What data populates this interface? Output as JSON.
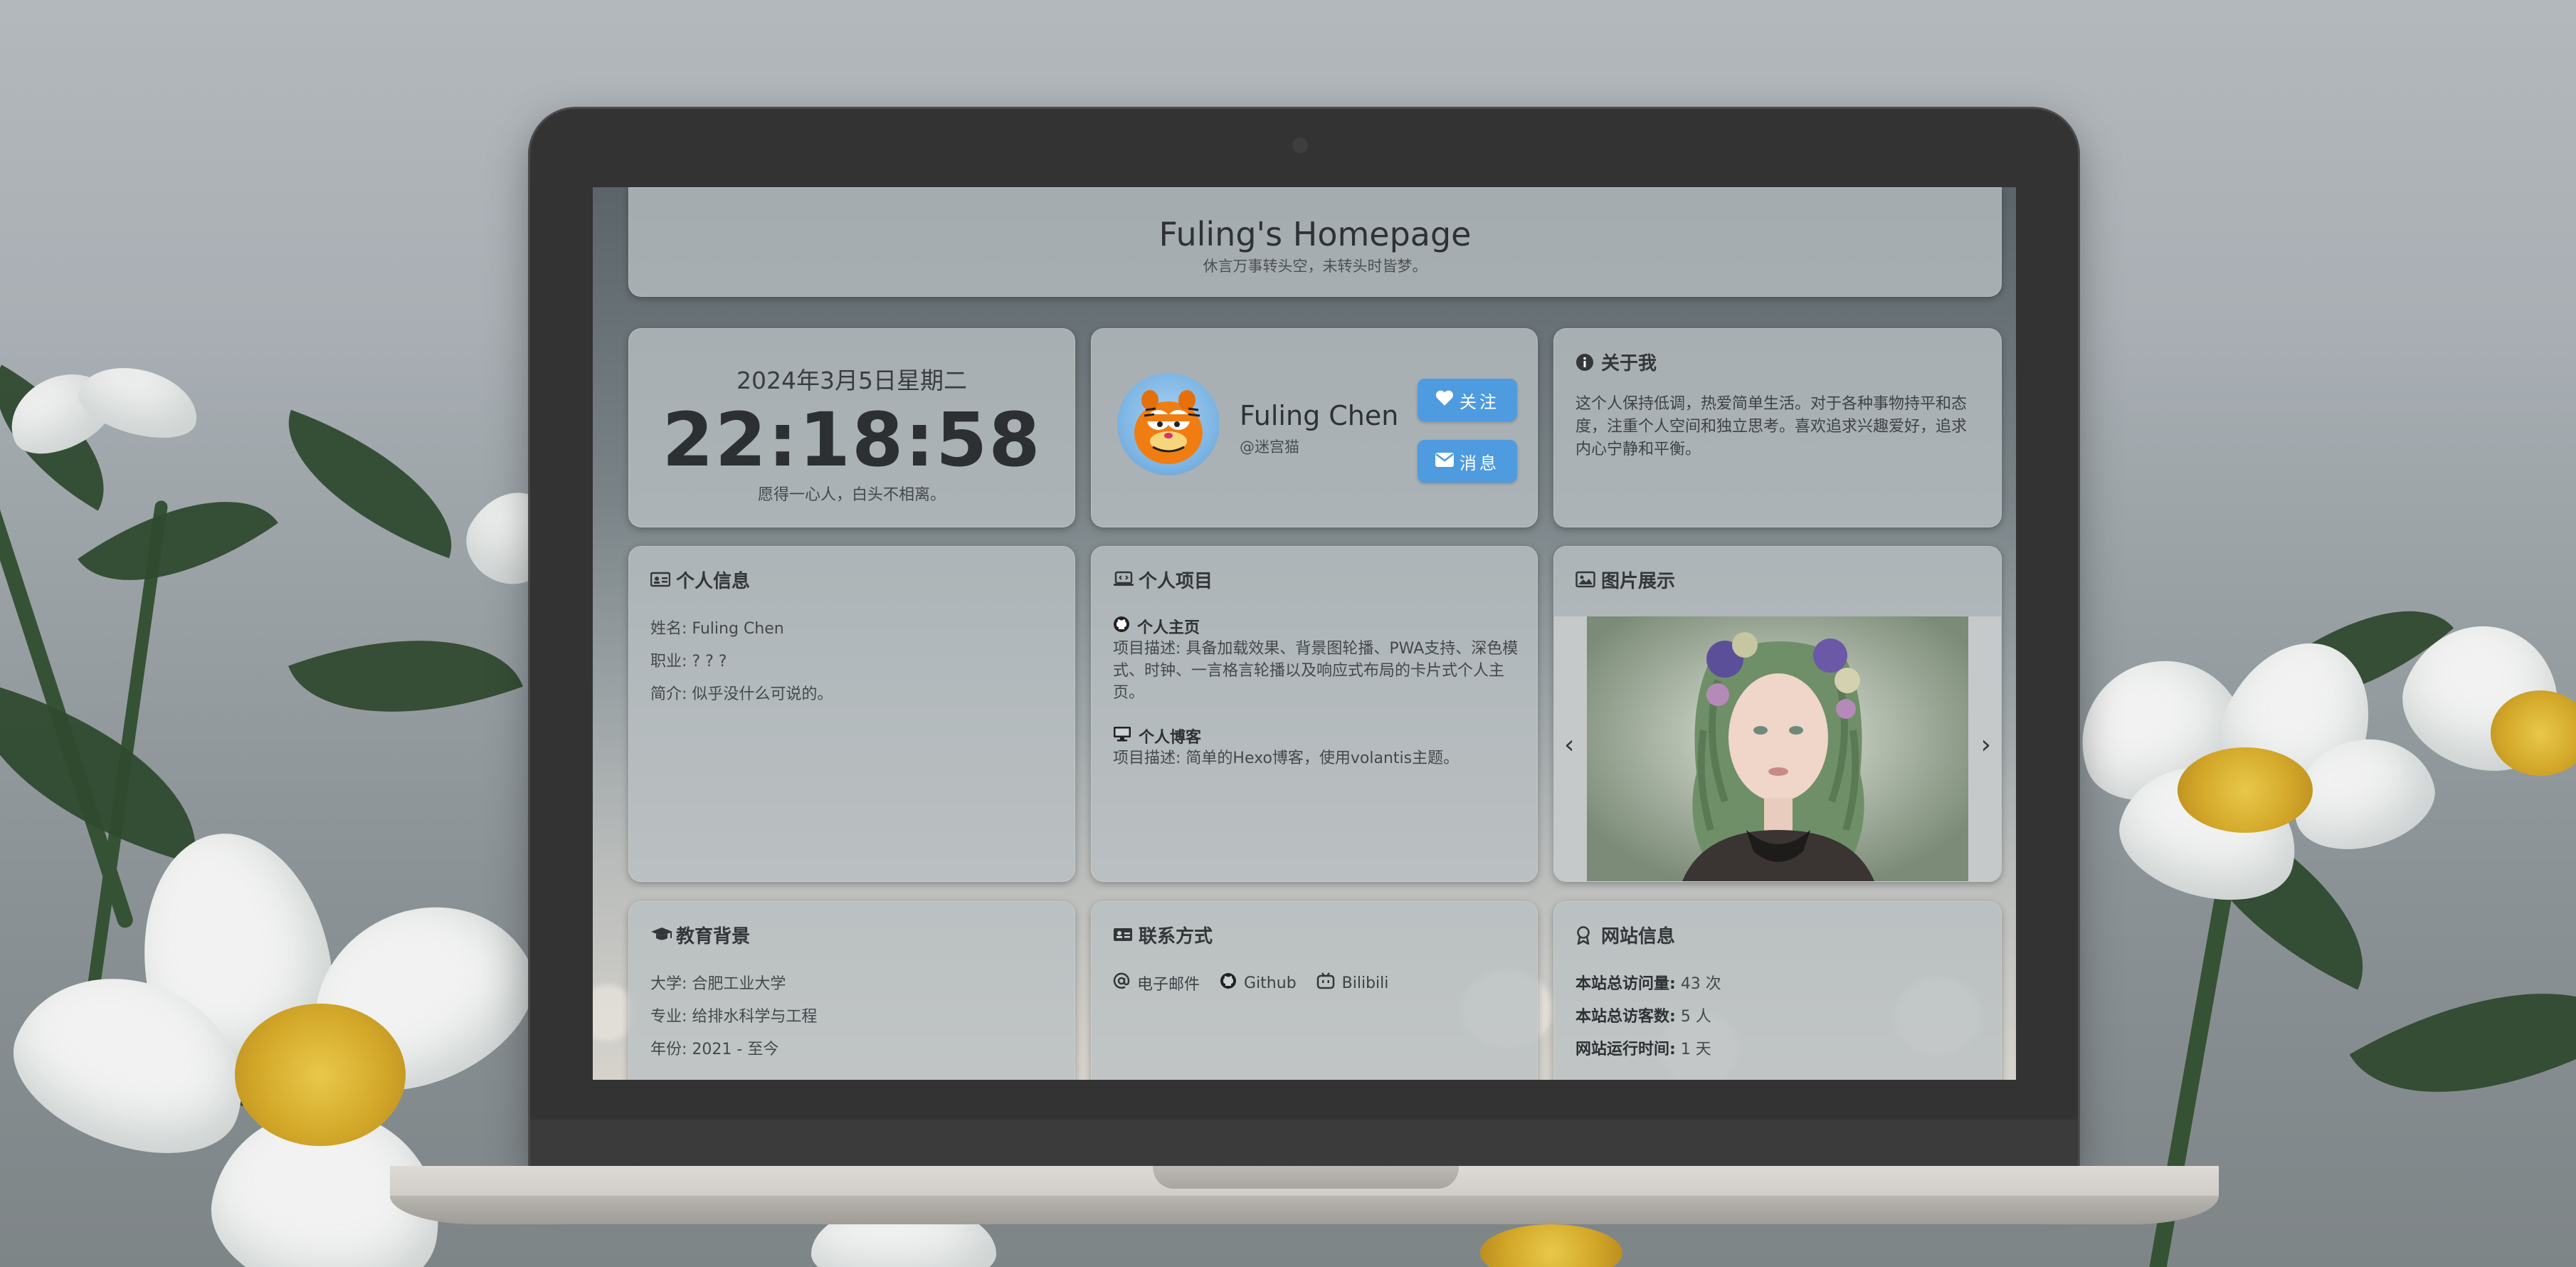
{
  "header": {
    "title": "Fuling's Homepage",
    "subtitle": "休言万事转头空，未转头时皆梦。"
  },
  "clock": {
    "date": "2024年3月5日星期二",
    "time": "22:18:58",
    "motto": "愿得一心人，白头不相离。"
  },
  "profile": {
    "name": "Fuling Chen",
    "handle": "@迷宫猫",
    "follow_label": "关注",
    "message_label": "消息"
  },
  "about": {
    "title": "关于我",
    "text": "这个人保持低调，热爱简单生活。对于各种事物持平和态度，注重个人空间和独立思考。喜欢追求兴趣爱好，追求内心宁静和平衡。"
  },
  "personal_info": {
    "title": "个人信息",
    "name_line": "姓名: Fuling Chen",
    "job_line": "职业: ? ? ?",
    "bio_line": "简介: 似乎没什么可说的。"
  },
  "projects": {
    "title": "个人项目",
    "items": [
      {
        "name": "个人主页",
        "desc": "项目描述: 具备加载效果、背景图轮播、PWA支持、深色模式、时钟、一言格言轮播以及响应式布局的卡片式个人主页。"
      },
      {
        "name": "个人博客",
        "desc": "项目描述: 简单的Hexo博客，使用volantis主题。"
      }
    ]
  },
  "gallery": {
    "title": "图片展示",
    "prev": "‹",
    "next": "›"
  },
  "education": {
    "title": "教育背景",
    "school_line": "大学: 合肥工业大学",
    "major_line": "专业: 给排水科学与工程",
    "years_line": "年份: 2021 - 至今"
  },
  "contact": {
    "title": "联系方式",
    "email": "电子邮件",
    "github": "Github",
    "bilibili": "Bilibili"
  },
  "site_info": {
    "title": "网站信息",
    "visits_label": "本站总访问量:",
    "visits_value": "43 次",
    "visitors_label": "本站总访客数:",
    "visitors_value": "5 人",
    "uptime_label": "网站运行时间:",
    "uptime_value": "1 天"
  },
  "colors": {
    "accent": "#4e9be0",
    "card": "#bac0c3",
    "laptop": "#333334"
  }
}
